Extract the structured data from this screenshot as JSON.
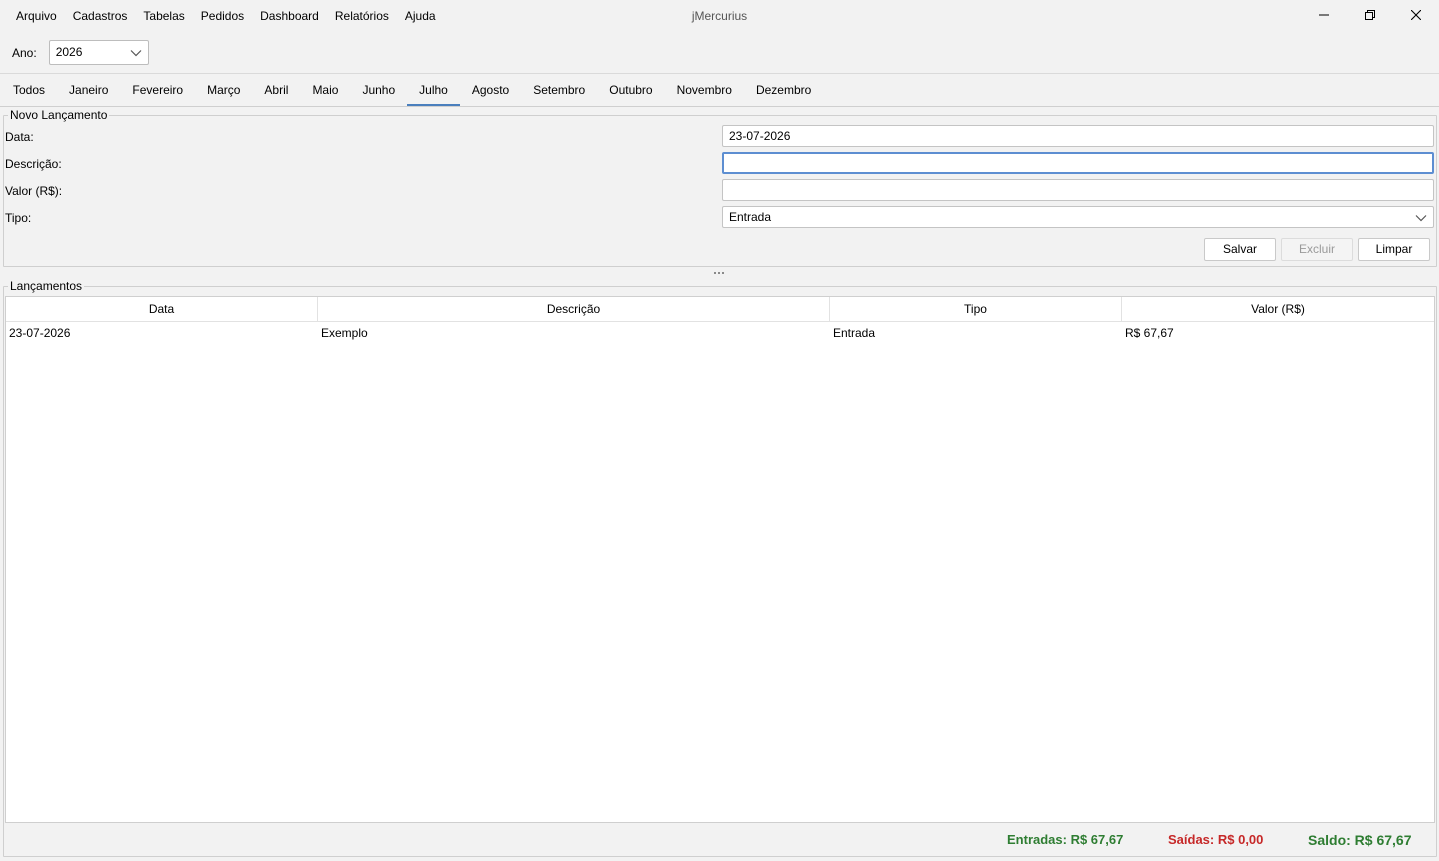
{
  "app": {
    "title": "jMercurius"
  },
  "menu": [
    "Arquivo",
    "Cadastros",
    "Tabelas",
    "Pedidos",
    "Dashboard",
    "Relatórios",
    "Ajuda"
  ],
  "year": {
    "label": "Ano:",
    "value": "2026"
  },
  "tabs": [
    "Todos",
    "Janeiro",
    "Fevereiro",
    "Março",
    "Abril",
    "Maio",
    "Junho",
    "Julho",
    "Agosto",
    "Setembro",
    "Outubro",
    "Novembro",
    "Dezembro"
  ],
  "active_tab": "Julho",
  "form": {
    "title": "Novo Lançamento",
    "data_label": "Data:",
    "data_value": "23-07-2026",
    "descricao_label": "Descrição:",
    "descricao_value": "",
    "valor_label": "Valor (R$):",
    "valor_value": "",
    "tipo_label": "Tipo:",
    "tipo_value": "Entrada",
    "save": "Salvar",
    "delete": "Excluir",
    "clear": "Limpar"
  },
  "list": {
    "title": "Lançamentos",
    "columns": [
      "Data",
      "Descrição",
      "Tipo",
      "Valor (R$)"
    ],
    "rows": [
      [
        "23-07-2026",
        "Exemplo",
        "Entrada",
        "R$ 67,67"
      ]
    ]
  },
  "totals": {
    "entradas": "Entradas: R$ 67,67",
    "saidas": "Saídas: R$ 0,00",
    "saldo": "Saldo: R$ 67,67"
  },
  "colors": {
    "accent": "#4a7fbd",
    "positive": "#2e7d32",
    "negative": "#c62828"
  }
}
